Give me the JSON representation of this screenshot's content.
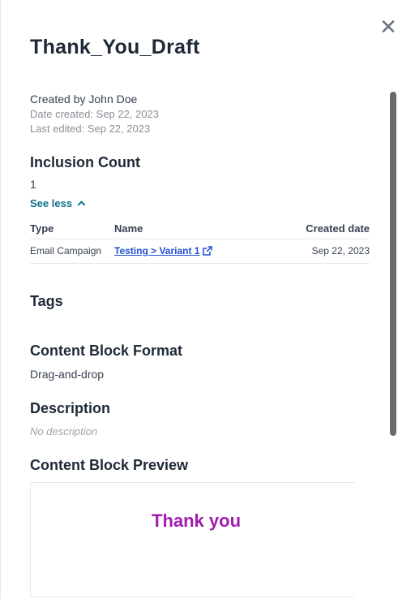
{
  "panel": {
    "title": "Thank_You_Draft",
    "close_icon": "close-icon"
  },
  "meta": {
    "created_by": "Created by John Doe",
    "date_created": "Date created: Sep 22, 2023",
    "last_edited": "Last edited: Sep 22, 2023"
  },
  "inclusion": {
    "heading": "Inclusion Count",
    "count": "1",
    "toggle_label": "See less",
    "columns": [
      "Type",
      "Name",
      "Created date"
    ],
    "rows": [
      {
        "type": "Email Campaign",
        "name": "Testing > Variant 1",
        "created": "Sep 22, 2023"
      }
    ]
  },
  "tags": {
    "heading": "Tags"
  },
  "format": {
    "heading": "Content Block Format",
    "value": "Drag-and-drop"
  },
  "description": {
    "heading": "Description",
    "value": "No description"
  },
  "preview": {
    "heading": "Content Block Preview",
    "text": "Thank you",
    "text_color": "#a21caf"
  },
  "colors": {
    "link": "#1f4fd1",
    "accent": "#0e6e8c"
  }
}
